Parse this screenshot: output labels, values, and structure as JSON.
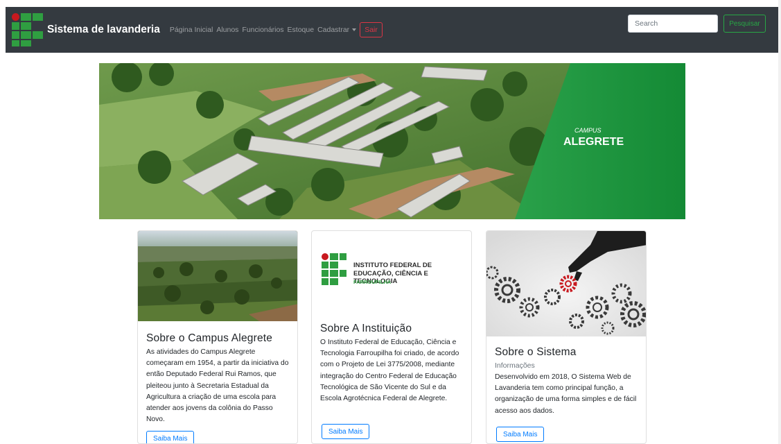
{
  "navbar": {
    "brand": "Sistema de lavanderia",
    "links": [
      "Página Inicial",
      "Alunos",
      "Funcionários",
      "Estoque"
    ],
    "dropdown_label": "Cadastrar",
    "logout_label": "Sair",
    "search_placeholder": "Search",
    "search_button": "Pesquisar"
  },
  "hero": {
    "campus_small": "CAMPUS",
    "campus_big": "ALEGRETE"
  },
  "cards": [
    {
      "title": "Sobre o Campus Alegrete",
      "text": "As atividades do Campus Alegrete começaram em 1954, a partir da iniciativa do então Deputado Federal Rui Ramos, que pleiteou junto à Secretaria Estadual da Agricultura a criação de uma escola para atender aos jovens da colônia do Passo Novo.",
      "button": "Saiba Mais"
    },
    {
      "logo_line1": "INSTITUTO FEDERAL DE",
      "logo_line2": "EDUCAÇÃO, CIÊNCIA E TECNOLOGIA",
      "logo_line3": "FARROUPILHA",
      "title": "Sobre A Instituição",
      "text": "O Instituto Federal de Educação, Ciência e Tecnologia Farroupilha foi criado, de acordo com o Projeto de Lei 3775/2008, mediante integração do Centro Federal de Educação Tecnológica de São Vicente do Sul e da Escola Agrotécnica Federal de Alegrete.",
      "button": "Saiba Mais"
    },
    {
      "title": "Sobre o Sistema",
      "subtitle": "Informações",
      "text": "Desenvolvido em 2018, O Sistema Web de Lavanderia tem como principal função, a organização de uma forma simples e de fácil acesso aos dados.",
      "button": "Saiba Mais"
    }
  ],
  "colors": {
    "navbar_bg": "#343a40",
    "brand_green": "#2f9e41",
    "brand_red": "#c8191f",
    "danger": "#dc3545",
    "success": "#28a745",
    "primary": "#007bff"
  }
}
